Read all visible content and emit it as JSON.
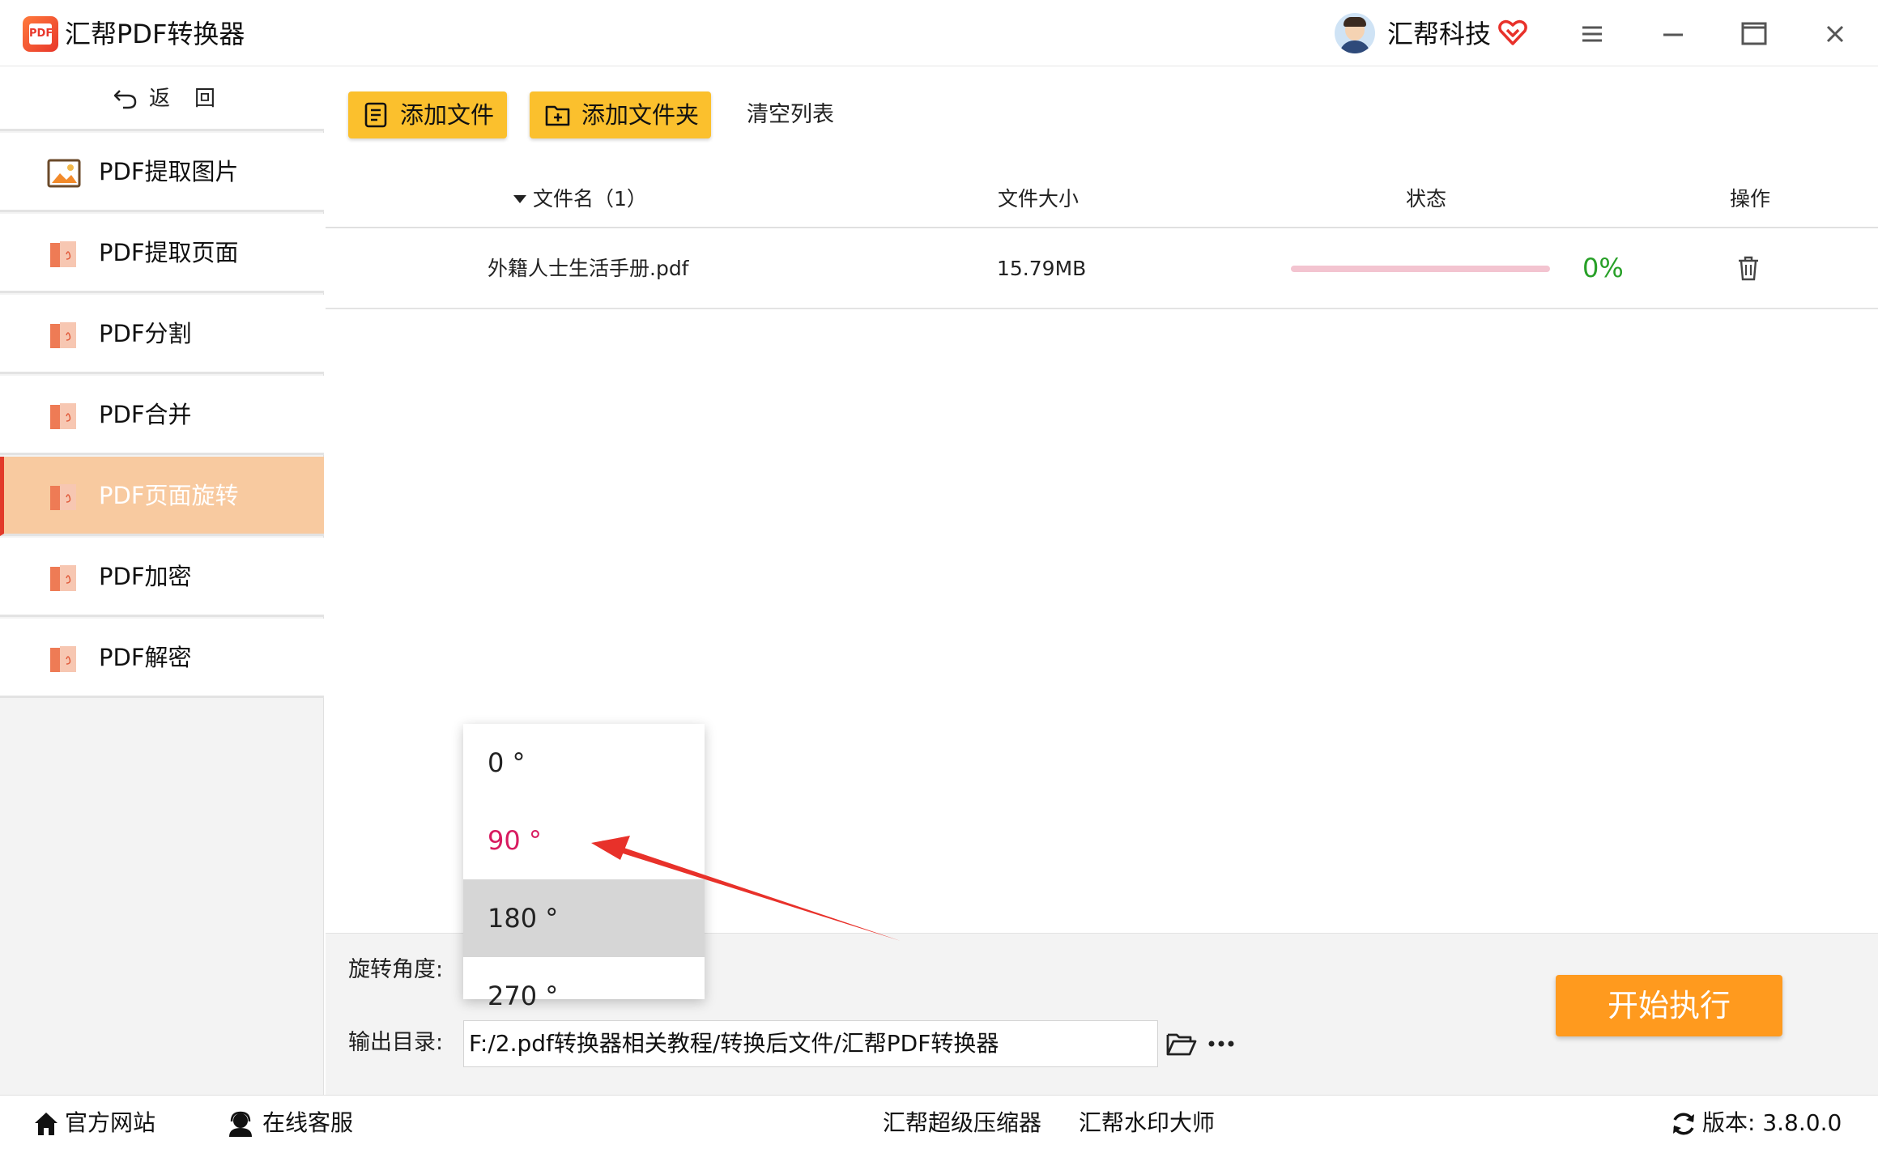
{
  "app": {
    "title": "汇帮PDF转换器",
    "logo_text": "PDF",
    "company": "汇帮科技"
  },
  "sidebar": {
    "back_label": "返回",
    "items": [
      {
        "label": "PDF提取图片",
        "icon": "image-icon"
      },
      {
        "label": "PDF提取页面",
        "icon": "pdf-file-icon"
      },
      {
        "label": "PDF分割",
        "icon": "pdf-file-icon"
      },
      {
        "label": "PDF合并",
        "icon": "pdf-file-icon"
      },
      {
        "label": "PDF页面旋转",
        "icon": "pdf-file-icon",
        "active": true
      },
      {
        "label": "PDF加密",
        "icon": "pdf-file-icon"
      },
      {
        "label": "PDF解密",
        "icon": "pdf-file-icon"
      }
    ]
  },
  "toolbar": {
    "add_file": "添加文件",
    "add_folder": "添加文件夹",
    "clear_list": "清空列表"
  },
  "table": {
    "headers": {
      "name": "文件名（1）",
      "size": "文件大小",
      "status": "状态",
      "action": "操作"
    },
    "rows": [
      {
        "name": "外籍人士生活手册.pdf",
        "size": "15.79MB",
        "progress": 0,
        "status": "0%"
      }
    ]
  },
  "settings": {
    "rotation_label": "旋转角度:",
    "output_label": "输出目录:",
    "output_path": "F:/2.pdf转换器相关教程/转换后文件/汇帮PDF转换器",
    "start_button": "开始执行",
    "rotation_options": [
      "0 °",
      "90 °",
      "180 °",
      "270 °"
    ],
    "rotation_selected": "90 °",
    "rotation_hovered": "180 °"
  },
  "statusbar": {
    "website": "官方网站",
    "support": "在线客服",
    "link1": "汇帮超级压缩器",
    "link2": "汇帮水印大师",
    "version": "版本:  3.8.0.0"
  },
  "colors": {
    "accent_yellow": "#fbc02d",
    "start_orange": "#ff9a1e",
    "active_nav": "#f8caa0",
    "selected_option": "#d81b60",
    "progress_text": "#28a028",
    "annotation_arrow": "#e8312a"
  }
}
